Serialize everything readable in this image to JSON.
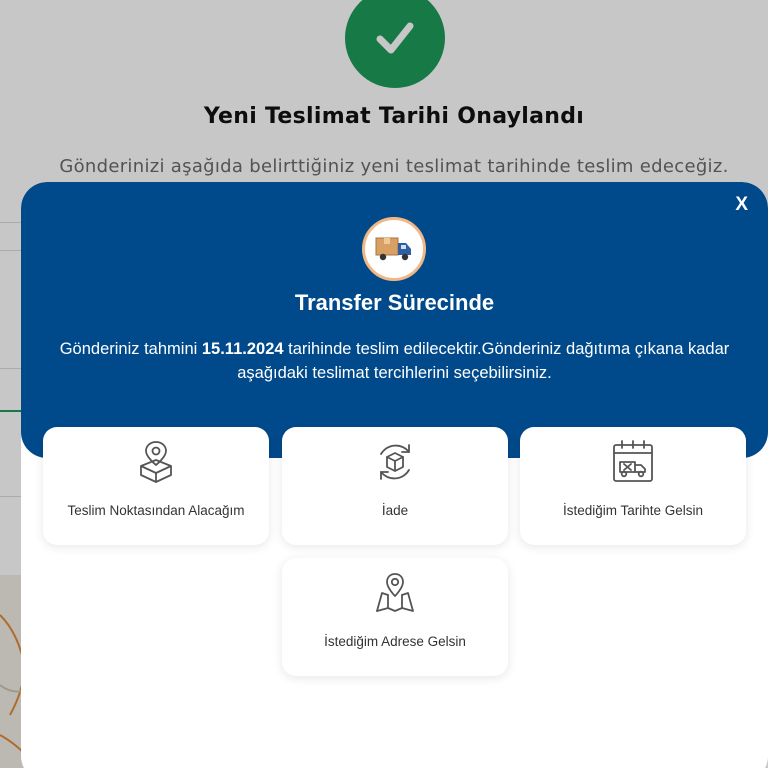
{
  "background": {
    "title": "Yeni Teslimat Tarihi Onaylandı",
    "subtitle": "Gönderinizi aşağıda belirttiğiniz yeni teslimat tarihinde teslim edeceğiz.",
    "check_color": "#1e9c5a"
  },
  "modal": {
    "close_label": "X",
    "title": "Transfer Sürecinde",
    "desc_prefix": "Gönderiniz tahmini ",
    "desc_date": "15.11.2024",
    "desc_suffix": " tarihinde teslim edilecektir.Gönderiniz dağıtıma çıkana kadar aşağıdaki teslimat tercihlerini seçebilirsiniz.",
    "header_color": "#004a8c",
    "options": [
      {
        "label": "Teslim Noktasından Alacağım",
        "icon": "location-box-icon"
      },
      {
        "label": "İade",
        "icon": "return-box-icon"
      },
      {
        "label": "İstediğim Tarihte Gelsin",
        "icon": "calendar-truck-icon"
      },
      {
        "label": "İstediğim Adrese Gelsin",
        "icon": "map-pin-icon"
      }
    ]
  }
}
